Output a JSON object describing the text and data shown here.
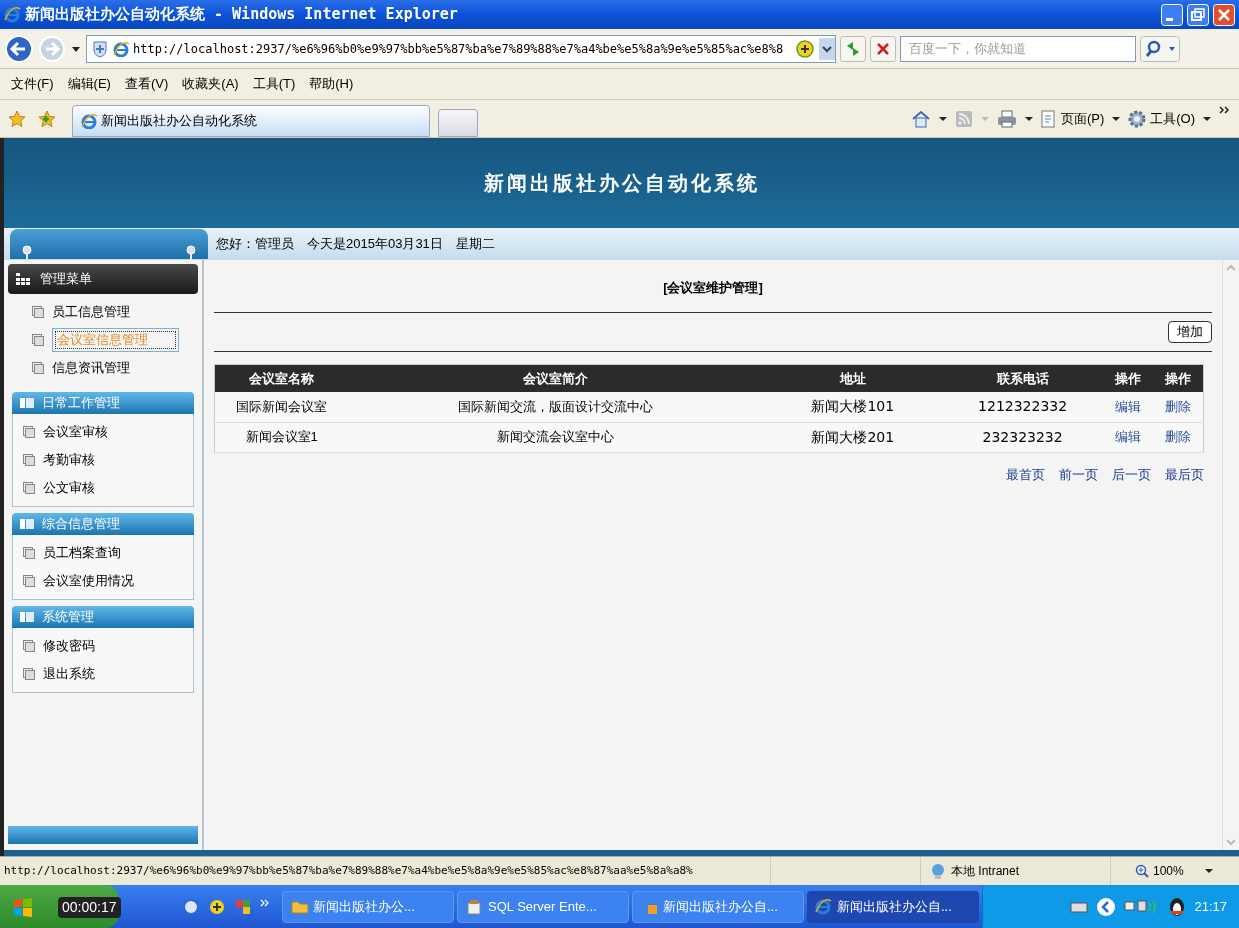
{
  "window": {
    "title": "新闻出版社办公自动化系统 - Windows Internet Explorer"
  },
  "address_bar": {
    "url": "http://localhost:2937/%e6%96%b0%e9%97%bb%e5%87%ba%e7%89%88%e7%a4%be%e5%8a%9e%e5%85%ac%e8%8"
  },
  "search": {
    "placeholder": "百度一下，你就知道"
  },
  "menu": [
    "文件(F)",
    "编辑(E)",
    "查看(V)",
    "收藏夹(A)",
    "工具(T)",
    "帮助(H)"
  ],
  "tabs": [
    {
      "label": "新闻出版社办公自动化系统",
      "selected": true
    }
  ],
  "command_bar": [
    "页面(P)",
    "工具(O)"
  ],
  "page": {
    "site_title": "新闻出版社办公自动化系统",
    "greeting": "您好：管理员　今天是2015年03月31日　星期二",
    "menu_groups": [
      {
        "kind": "main",
        "title": "管理菜单",
        "items": [
          {
            "label": "员工信息管理",
            "selected": false
          },
          {
            "label": "会议室信息管理",
            "selected": true
          },
          {
            "label": "信息资讯管理",
            "selected": false
          }
        ]
      },
      {
        "kind": "sub",
        "title": "日常工作管理",
        "items": [
          {
            "label": "会议室审核",
            "selected": false
          },
          {
            "label": "考勤审核",
            "selected": false
          },
          {
            "label": "公文审核",
            "selected": false
          }
        ]
      },
      {
        "kind": "sub",
        "title": "综合信息管理",
        "items": [
          {
            "label": "员工档案查询",
            "selected": false
          },
          {
            "label": "会议室使用情况",
            "selected": false
          }
        ]
      },
      {
        "kind": "sub",
        "title": "系统管理",
        "items": [
          {
            "label": "修改密码",
            "selected": false
          },
          {
            "label": "退出系统",
            "selected": false
          }
        ]
      }
    ],
    "section_title": "[会议室维护管理]",
    "add_button": "增加",
    "table": {
      "columns": [
        "会议室名称",
        "会议室简介",
        "地址",
        "联系电话",
        "操作",
        "操作"
      ],
      "rows": [
        {
          "cells": [
            "国际新闻会议室",
            "国际新闻交流，版面设计交流中心",
            "新闻大楼101",
            "1212322332"
          ],
          "actions": [
            "编辑",
            "删除"
          ]
        },
        {
          "cells": [
            "新闻会议室1",
            "新闻交流会议室中心",
            "新闻大楼201",
            "232323232"
          ],
          "actions": [
            "编辑",
            "删除"
          ]
        }
      ]
    },
    "pager": [
      "最首页",
      "前一页",
      "后一页",
      "最后页"
    ]
  },
  "status_bar": {
    "url": "http://localhost:2937/%e6%96%b0%e9%97%bb%e5%87%ba%e7%89%88%e7%a4%be%e5%8a%9e%e5%85%ac%e8%87%aa%e5%8a%a8%",
    "zone": "本地 Intranet",
    "zoom": "100%"
  },
  "taskbar": {
    "timer": "00:00:17",
    "tasks": [
      {
        "label": "新闻出版社办公...",
        "selected": false
      },
      {
        "label": "SQL Server Ente...",
        "selected": false
      },
      {
        "label": "新闻出版社办公自...",
        "selected": false
      },
      {
        "label": "新闻出版社办公自...",
        "selected": true
      }
    ],
    "clock": "21:17"
  }
}
